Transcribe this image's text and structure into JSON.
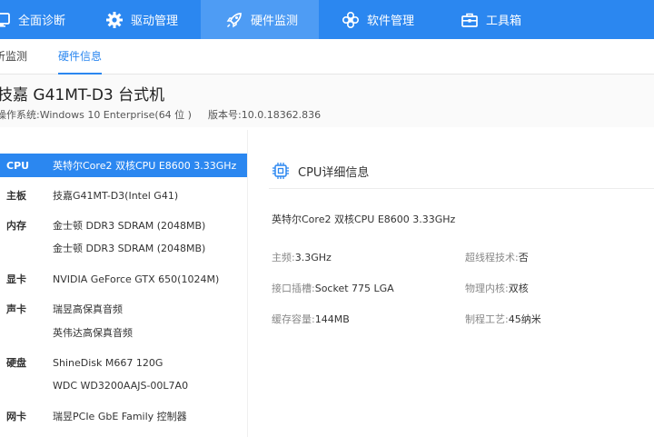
{
  "nav": {
    "items": [
      {
        "label": "全面诊断",
        "icon": "monitor-icon"
      },
      {
        "label": "驱动管理",
        "icon": "gear-icon"
      },
      {
        "label": "硬件监测",
        "icon": "rocket-icon",
        "active": true
      },
      {
        "label": "软件管理",
        "icon": "flower-icon"
      },
      {
        "label": "工具箱",
        "icon": "toolbox-icon"
      }
    ]
  },
  "subtabs": [
    {
      "label": "析监测"
    },
    {
      "label": "硬件信息",
      "active": true
    }
  ],
  "machine": {
    "name": "技嘉 G41MT-D3 台式机",
    "os_label": "操作系统:",
    "os_value": "Windows 10 Enterprise(64 位 )",
    "version_label": "版本号:",
    "version_value": "10.0.18362.836"
  },
  "hardware": [
    {
      "category": "CPU",
      "value": "英特尔Core2 双核CPU E8600 3.33GHz",
      "selected": true
    },
    {
      "category": "主板",
      "value": "技嘉G41MT-D3(Intel G41)"
    },
    {
      "category": "内存",
      "value": "金士顿 DDR3 SDRAM (2048MB)"
    },
    {
      "category": "",
      "value": "金士顿 DDR3 SDRAM (2048MB)"
    },
    {
      "category": "显卡",
      "value": "NVIDIA GeForce GTX 650(1024M)"
    },
    {
      "category": "声卡",
      "value": "瑞昱高保真音频"
    },
    {
      "category": "",
      "value": "英伟达高保真音频"
    },
    {
      "category": "硬盘",
      "value": "ShineDisk M667 120G"
    },
    {
      "category": "",
      "value": "WDC WD3200AAJS-00L7A0"
    },
    {
      "category": "网卡",
      "value": "瑞昱PCIe GbE Family 控制器"
    }
  ],
  "detail": {
    "title": "CPU详细信息",
    "cpu_full_name": "英特尔Core2 双核CPU E8600 3.33GHz",
    "props": [
      {
        "key": "主频:",
        "value": "3.3GHz"
      },
      {
        "key": "超线程技术:",
        "value": "否"
      },
      {
        "key": "接口插槽:",
        "value": "Socket 775 LGA"
      },
      {
        "key": "物理内核:",
        "value": "双核"
      },
      {
        "key": "缓存容量:",
        "value": "144MB"
      },
      {
        "key": "制程工艺:",
        "value": "45纳米"
      }
    ]
  },
  "colors": {
    "accent": "#2b87f0",
    "nav_active": "#4e9cf4"
  }
}
